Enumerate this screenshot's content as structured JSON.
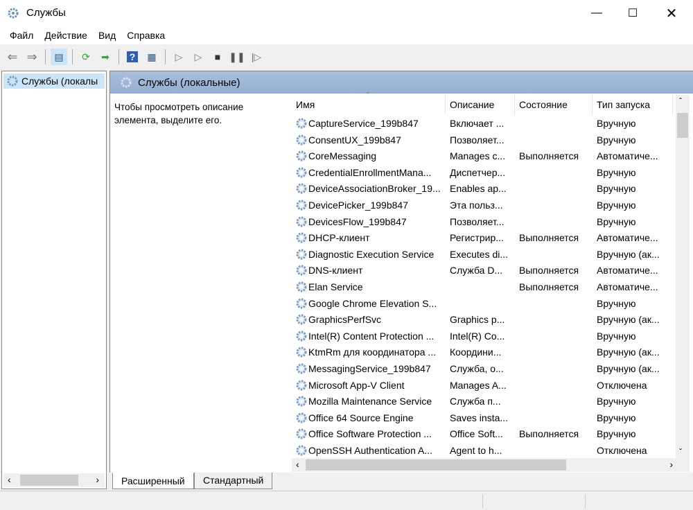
{
  "window": {
    "title": "Службы",
    "icon": "gear-icon"
  },
  "menu": [
    "Файл",
    "Действие",
    "Вид",
    "Справка"
  ],
  "toolbar": [
    "back-icon",
    "forward-icon",
    "show-hide-tree-icon",
    "refresh-icon",
    "export-icon",
    "help-icon",
    "properties-icon",
    "start-icon",
    "start-alt-icon",
    "stop-icon",
    "pause-icon",
    "resume-icon"
  ],
  "tree": {
    "item": "Службы (локалы"
  },
  "main": {
    "header": "Службы (локальные)",
    "description": "Чтобы просмотреть описание элемента, выделите его."
  },
  "columns": [
    "Имя",
    "Описание",
    "Состояние",
    "Тип запуска"
  ],
  "rows": [
    [
      "CaptureService_199b847",
      "Включает ...",
      "",
      "Вручную"
    ],
    [
      "ConsentUX_199b847",
      "Позволяет...",
      "",
      "Вручную"
    ],
    [
      "CoreMessaging",
      "Manages c...",
      "Выполняется",
      "Автоматиче..."
    ],
    [
      "CredentialEnrollmentMana...",
      "Диспетчер...",
      "",
      "Вручную"
    ],
    [
      "DeviceAssociationBroker_19...",
      "Enables ap...",
      "",
      "Вручную"
    ],
    [
      "DevicePicker_199b847",
      "Эта польз...",
      "",
      "Вручную"
    ],
    [
      "DevicesFlow_199b847",
      "Позволяет...",
      "",
      "Вручную"
    ],
    [
      "DHCP-клиент",
      "Регистрир...",
      "Выполняется",
      "Автоматиче..."
    ],
    [
      "Diagnostic Execution Service",
      "Executes di...",
      "",
      "Вручную (ак..."
    ],
    [
      "DNS-клиент",
      "Служба D...",
      "Выполняется",
      "Автоматиче..."
    ],
    [
      "Elan Service",
      "",
      "Выполняется",
      "Автоматиче..."
    ],
    [
      "Google Chrome Elevation S...",
      "",
      "",
      "Вручную"
    ],
    [
      "GraphicsPerfSvc",
      "Graphics p...",
      "",
      "Вручную (ак..."
    ],
    [
      "Intel(R) Content Protection ...",
      "Intel(R) Co...",
      "",
      "Вручную"
    ],
    [
      "KtmRm для координатора ...",
      "Координи...",
      "",
      "Вручную (ак..."
    ],
    [
      "MessagingService_199b847",
      "Служба, о...",
      "",
      "Вручную (ак..."
    ],
    [
      "Microsoft App-V Client",
      "Manages A...",
      "",
      "Отключена"
    ],
    [
      "Mozilla Maintenance Service",
      "Служба п...",
      "",
      "Вручную"
    ],
    [
      "Office 64 Source Engine",
      "Saves insta...",
      "",
      "Вручную"
    ],
    [
      "Office Software Protection ...",
      "Office Soft...",
      "Выполняется",
      "Вручную"
    ],
    [
      "OpenSSH Authentication A...",
      "Agent to h...",
      "",
      "Отключена"
    ]
  ],
  "tabs": [
    "Расширенный",
    "Стандартный"
  ],
  "colors": {
    "header": "#9fb6d6",
    "selection": "#cce4f7"
  }
}
